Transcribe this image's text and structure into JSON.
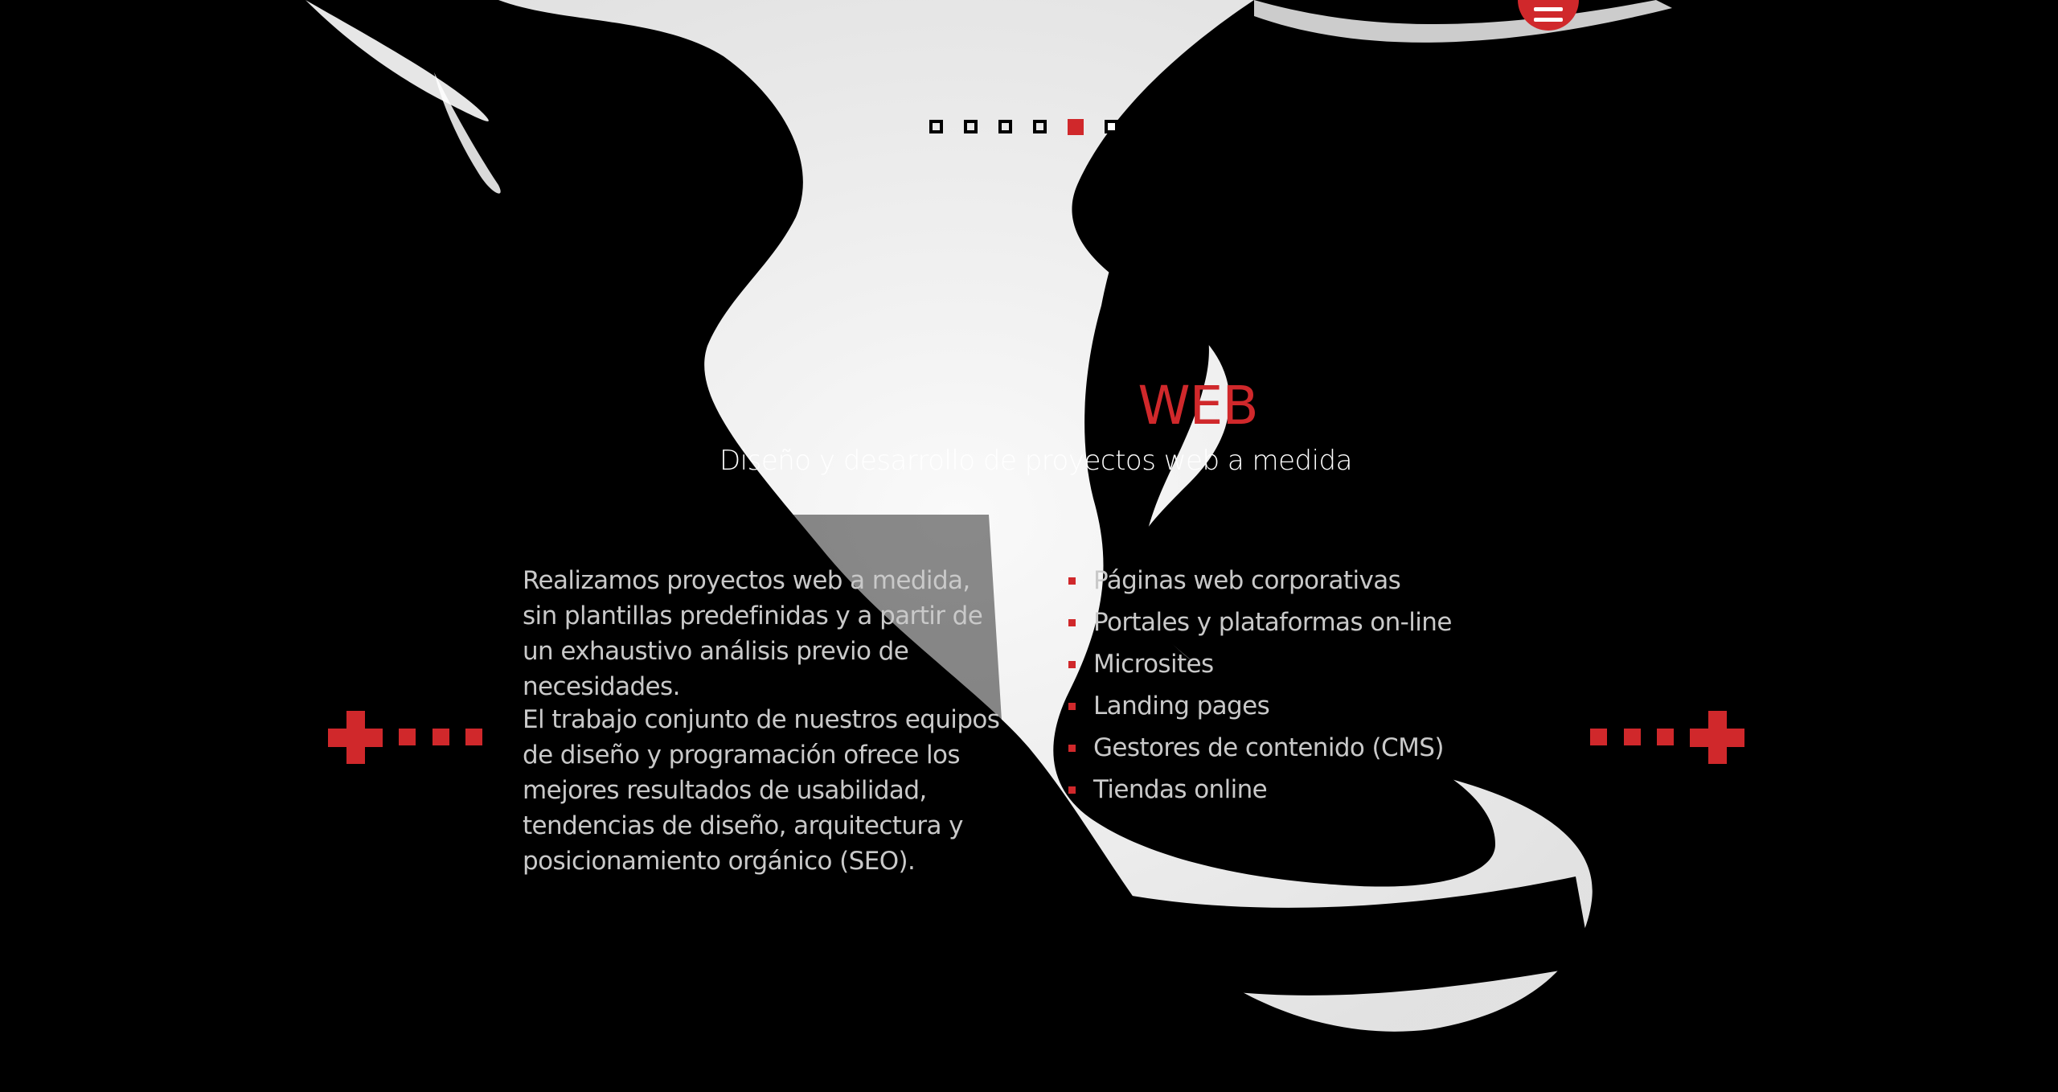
{
  "menu": {
    "label": "Menú"
  },
  "slider": {
    "dot_count": 6,
    "active_index": 4
  },
  "section": {
    "title": "WEB",
    "subtitle": "Diseño y desarrollo de proyectos web a medida"
  },
  "content": {
    "paragraphs": [
      "Realizamos proyectos web a medida, sin plantillas predefinidas y a partir de un exhaustivo análisis previo de necesidades.",
      "El trabajo conjunto de nuestros equipos de diseño y programación ofrece los mejores resultados de usabilidad, tendencias de diseño, arquitectura y posicionamiento orgánico (SEO)."
    ],
    "features": [
      "Páginas web corporativas",
      "Portales y plataformas on-line",
      "Microsites",
      "Landing pages",
      "Gestores de contenido (CMS)",
      "Tiendas online"
    ]
  },
  "colors": {
    "accent": "#d0282b",
    "background": "#000000",
    "text": "#c9c9c9"
  }
}
